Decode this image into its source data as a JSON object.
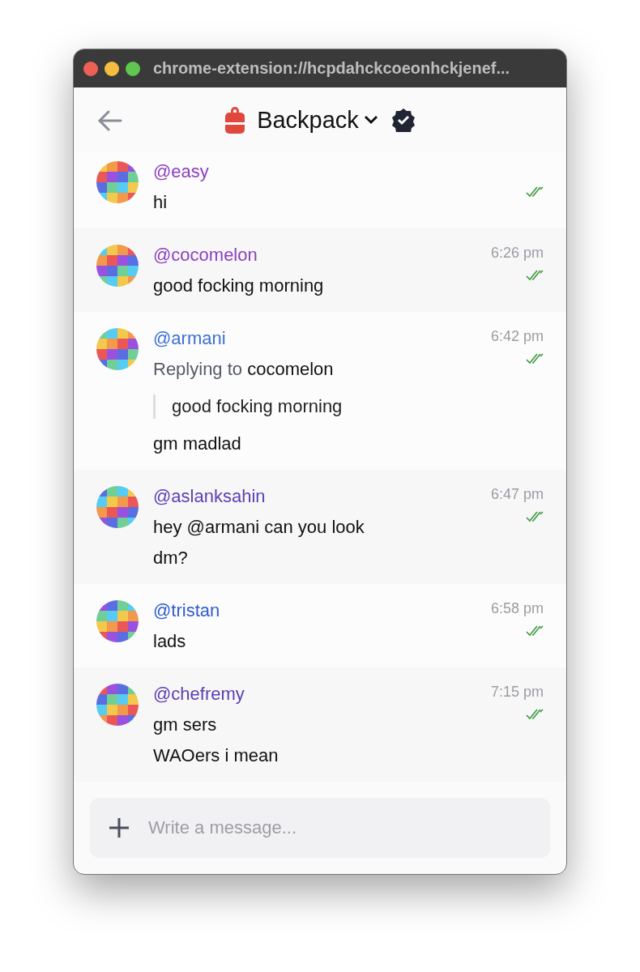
{
  "window": {
    "url": "chrome-extension://hcpdahckcoeonhckjenef..."
  },
  "header": {
    "title": "Backpack",
    "verified": true
  },
  "messages": [
    {
      "username": "@easy",
      "color": "#8e3fbf",
      "read": true,
      "lines": [
        "hi"
      ]
    },
    {
      "username": "@cocomelon",
      "color": "#8e3fbf",
      "time": "6:26 pm",
      "read": true,
      "lines": [
        "good focking morning"
      ]
    },
    {
      "username": "@armani",
      "color": "#3b6fd6",
      "time": "6:42 pm",
      "read": true,
      "reply": {
        "text": "Replying to **cocomelon**",
        "quote": "good focking morning"
      },
      "lines": [
        "gm madlad"
      ]
    },
    {
      "username": "@aslanksahin",
      "color": "#5b3fb5",
      "time": "6:47 pm",
      "read": true,
      "lines": [
        "hey @armani can you look",
        "dm?"
      ]
    },
    {
      "username": "@tristan",
      "color": "#2f5bd0",
      "time": "6:58 pm",
      "read": true,
      "lines": [
        "lads"
      ]
    },
    {
      "username": "@chefremy",
      "color": "#5a3fb0",
      "time": "7:15 pm",
      "read": true,
      "lines": [
        "gm sers",
        "WAOers i mean"
      ]
    }
  ],
  "composer": {
    "placeholder": "Write a message..."
  }
}
